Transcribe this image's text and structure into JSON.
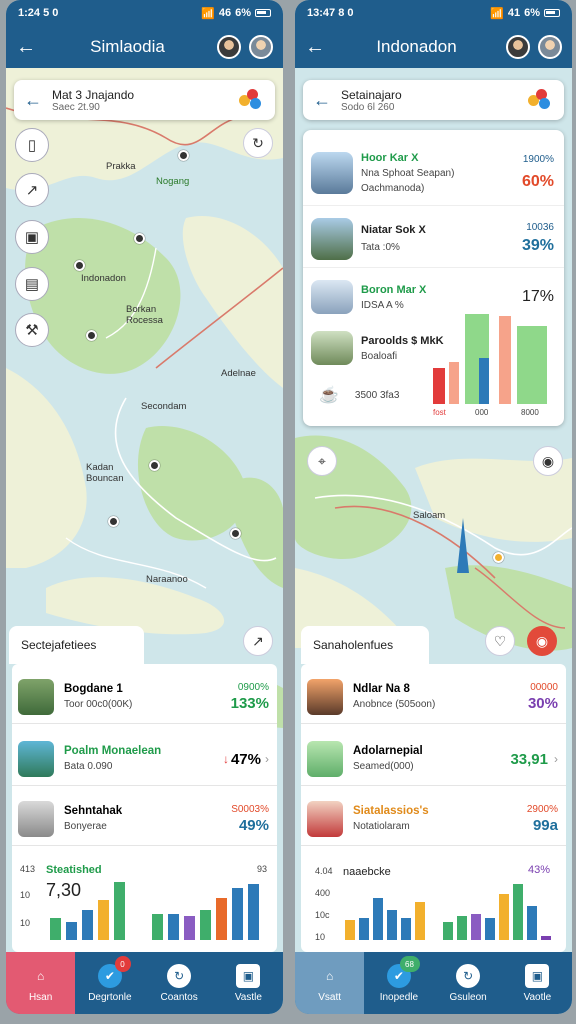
{
  "left": {
    "status": {
      "time": "1:24 5 0",
      "signal": "46",
      "battery": "6%"
    },
    "appbar": {
      "title": "Simlaodia"
    },
    "search": {
      "line1": "Mat 3 Jnajando",
      "line2": "Saec 2t.90"
    },
    "map_labels": [
      "Prakka",
      "Nogang",
      "Indonadon",
      "Borkan Rocessa",
      "Secondam",
      "Kadan Bouncan",
      "Adelnae",
      "Naraanoo"
    ],
    "section_tab": "Sectejafetiees",
    "rows": [
      {
        "name": "Bogdane 1",
        "sub": "Toor 00c0(00K)",
        "v1": "0900%",
        "v2": "133%",
        "v2color": "#1f9b4a"
      },
      {
        "name": "Poalm Monaelean",
        "sub": "Bata 0.090",
        "v1": "",
        "v2": "47%",
        "v2color": "#222",
        "name_color": "#1f9b4a"
      },
      {
        "name": "Sehntahak",
        "sub": "Bonyerae",
        "v1": "S0003%",
        "v2": "49%",
        "v2color": "#1f6f9c"
      }
    ],
    "chart": {
      "title": "Steatished",
      "big": "7,30",
      "ylabels": [
        "413",
        "10",
        "10"
      ],
      "corner": "93"
    },
    "nav": [
      "Hsan",
      "Degrtonle",
      "Coantos",
      "Vastle"
    ],
    "nav_badge": "0"
  },
  "right": {
    "status": {
      "time": "13:47 8 0",
      "signal": "41",
      "battery": "6%"
    },
    "appbar": {
      "title": "Indonadon"
    },
    "search": {
      "line1": "Setainajaro",
      "line2": "Sodo 6l 260"
    },
    "card_rows": [
      {
        "name": "Hoor Kar X",
        "sub": "Nna Sphoat Seapan)",
        "sub2": "Oachmanoda)",
        "v1": "1900%",
        "v2": "60%",
        "v2color": "#e24a2a"
      },
      {
        "name": "Niatar Sok X",
        "sub": "Tata :0%",
        "v1": "10036",
        "v2": "39%",
        "v2color": "#1f6f9c"
      },
      {
        "name": "Boron Mar X",
        "sub": "IDSA A %",
        "v1": "",
        "v2": "17%",
        "v2color": "#222"
      },
      {
        "name": "Paroolds $ MkK",
        "sub": "Boaloafi",
        "v1": "",
        "v2": "",
        "v2color": "#222"
      },
      {
        "name": "",
        "sub": "3500 3fa3",
        "v1": "",
        "v2": "",
        "v2color": "#222"
      }
    ],
    "card_chart_labels": [
      "fost",
      "000",
      "8000"
    ],
    "map_labels": [
      "Saloam"
    ],
    "section_tab": "Sanaholenfues",
    "rows": [
      {
        "name": "Ndlar Na 8",
        "sub": "Anobnce (505oon)",
        "v1": "00000",
        "v2": "30%",
        "v2color": "#7a3fb0"
      },
      {
        "name": "Adolarnepial",
        "sub": "Seamed(000)",
        "v1": "",
        "v2": "33,91",
        "v2color": "#1f9b4a"
      },
      {
        "name": "Siatalassios's",
        "sub": "Notatiolaram",
        "v1": "2900%",
        "v2": "99a",
        "v2color": "#1f6f9c",
        "name_color": "#e08a1a"
      }
    ],
    "chart": {
      "title": "naaebcke",
      "ylabels": [
        "4.04",
        "400",
        "10c",
        "10"
      ],
      "corner": "43%"
    },
    "nav": [
      "Vsatt",
      "Inopedle",
      "Gsuleon",
      "Vaotle"
    ],
    "nav_badge": "68"
  },
  "colors": {
    "primary": "#1f5d8c",
    "accent_red": "#e35a72",
    "green": "#1f9b4a"
  },
  "icons": {
    "status": [
      "wifi-icon",
      "signal-icon",
      "battery-icon"
    ],
    "tools": [
      "book-icon",
      "arrow-icon",
      "ticket-icon",
      "building-icon",
      "hammer-icon"
    ],
    "nav": [
      "home-icon",
      "pin-icon",
      "refresh-icon",
      "card-icon"
    ]
  }
}
